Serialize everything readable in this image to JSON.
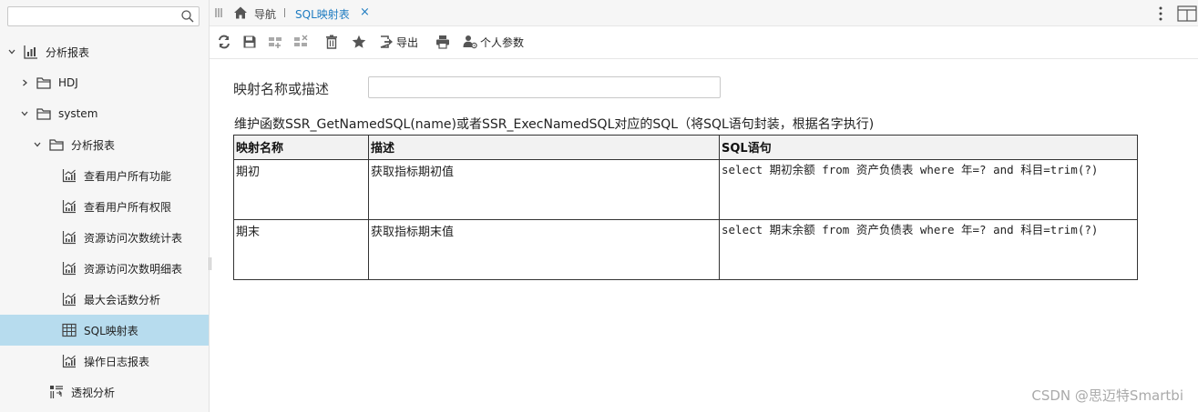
{
  "search": {
    "placeholder": ""
  },
  "sidebar": {
    "items": [
      {
        "label": "分析报表",
        "level": 0,
        "expand": "expanded",
        "icon": "analysis-report-icon"
      },
      {
        "label": "HDJ",
        "level": 1,
        "expand": "collapsed",
        "icon": "folder-icon"
      },
      {
        "label": "system",
        "level": 1,
        "expand": "expanded",
        "icon": "folder-icon"
      },
      {
        "label": "分析报表",
        "level": 2,
        "expand": "expanded",
        "icon": "folder-icon"
      },
      {
        "label": "查看用户所有功能",
        "level": 3,
        "expand": "none",
        "icon": "report-chart-icon"
      },
      {
        "label": "查看用户所有权限",
        "level": 3,
        "expand": "none",
        "icon": "report-chart-icon"
      },
      {
        "label": "资源访问次数统计表",
        "level": 3,
        "expand": "none",
        "icon": "report-chart-icon"
      },
      {
        "label": "资源访问次数明细表",
        "level": 3,
        "expand": "none",
        "icon": "report-chart-icon"
      },
      {
        "label": "最大会话数分析",
        "level": 3,
        "expand": "none",
        "icon": "report-chart-icon"
      },
      {
        "label": "SQL映射表",
        "level": 3,
        "expand": "none",
        "icon": "table-icon",
        "selected": true
      },
      {
        "label": "操作日志报表",
        "level": 3,
        "expand": "none",
        "icon": "report-chart-icon"
      },
      {
        "label": "透视分析",
        "level": 2,
        "expand": "none",
        "icon": "pivot-analysis-icon"
      }
    ]
  },
  "tabbar": {
    "nav_label": "导航",
    "active_tab": "SQL映射表",
    "close_glyph": "×"
  },
  "toolbar": {
    "export_label": "导出",
    "personal_params_label": "个人参数"
  },
  "form": {
    "field_label": "映射名称或描述",
    "field_value": ""
  },
  "description": "维护函数SSR_GetNamedSQL(name)或者SSR_ExecNamedSQL对应的SQL（将SQL语句封装，根据名字执行)",
  "table": {
    "headers": [
      "映射名称",
      "描述",
      "SQL语句"
    ],
    "rows": [
      [
        "期初",
        "获取指标期初值",
        "select 期初余额 from 资产负债表 where 年=? and 科目=trim(?)"
      ],
      [
        "期末",
        "获取指标期末值",
        "select 期末余额 from 资产负债表 where 年=? and 科目=trim(?)"
      ]
    ]
  },
  "watermark": "CSDN @思迈特Smartbi",
  "colors": {
    "accent": "#1f7cc1",
    "selected_bg": "#b7dcee",
    "sidebar_bg": "#f6f6f6"
  }
}
